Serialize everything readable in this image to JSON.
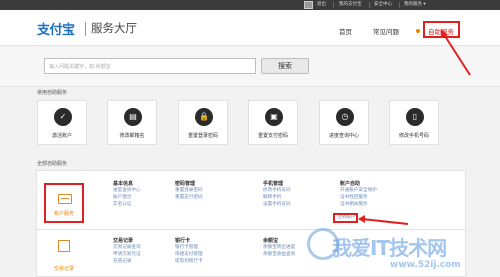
{
  "topbar": {
    "items": [
      "退出",
      "我的支付宝",
      "安全中心",
      "我的服务 ▾"
    ]
  },
  "header": {
    "logo": "支付宝",
    "subtitle": "服务大厅",
    "nav": [
      "首页",
      "常见问题"
    ],
    "active_nav": "自助服务"
  },
  "search": {
    "placeholder": "输入问题关键字，如:余额宝",
    "button": "搜索"
  },
  "quick": {
    "title": "常用自助服务",
    "items": [
      {
        "label": "激活账户",
        "icon": "user-check-icon",
        "glyph": "✓"
      },
      {
        "label": "修改邮箱名",
        "icon": "id-card-icon",
        "glyph": "▤"
      },
      {
        "label": "重置登录密码",
        "icon": "lock-icon",
        "glyph": "🔒"
      },
      {
        "label": "重置支付密码",
        "icon": "safe-icon",
        "glyph": "▣"
      },
      {
        "label": "进度查询中心",
        "icon": "clock-icon",
        "glyph": "◷"
      },
      {
        "label": "修改手机号码",
        "icon": "phone-icon",
        "glyph": "▯"
      }
    ]
  },
  "all": {
    "title": "全部自助服务",
    "account_service": "帐户服务",
    "trade_record": "交易记录",
    "columns": [
      {
        "heading": "基本信息",
        "links": [
          "进度查询中心",
          "账户激活",
          "实名认证"
        ]
      },
      {
        "heading": "密码管理",
        "links": [
          "重置登录密码",
          "重置支付密码"
        ]
      },
      {
        "heading": "手机管理",
        "links": [
          "修改手机号码",
          "解绑手机",
          "设置手机号码"
        ]
      },
      {
        "heading": "账户自助",
        "links": [
          "开通账户安全保护",
          "证书找回服务",
          "证书相关服务",
          "注销账户"
        ]
      }
    ],
    "columns2": [
      {
        "heading": "交易记录",
        "links": [
          "交易记录查询",
          "申请交易凭证",
          "充值记录"
        ]
      },
      {
        "heading": "银行卡",
        "links": [
          "银行卡管理",
          "快捷支付管理",
          "提现到银行卡"
        ]
      },
      {
        "heading": "余额宝",
        "links": [
          "余额宝转出进度",
          "余额宝收益查询"
        ]
      }
    ]
  },
  "watermark": {
    "text": "我爱IT技术网",
    "url": "www.52ij.com"
  },
  "colors": {
    "brand": "#1d6fc0",
    "accent": "#f08300",
    "highlight": "#e02020"
  }
}
